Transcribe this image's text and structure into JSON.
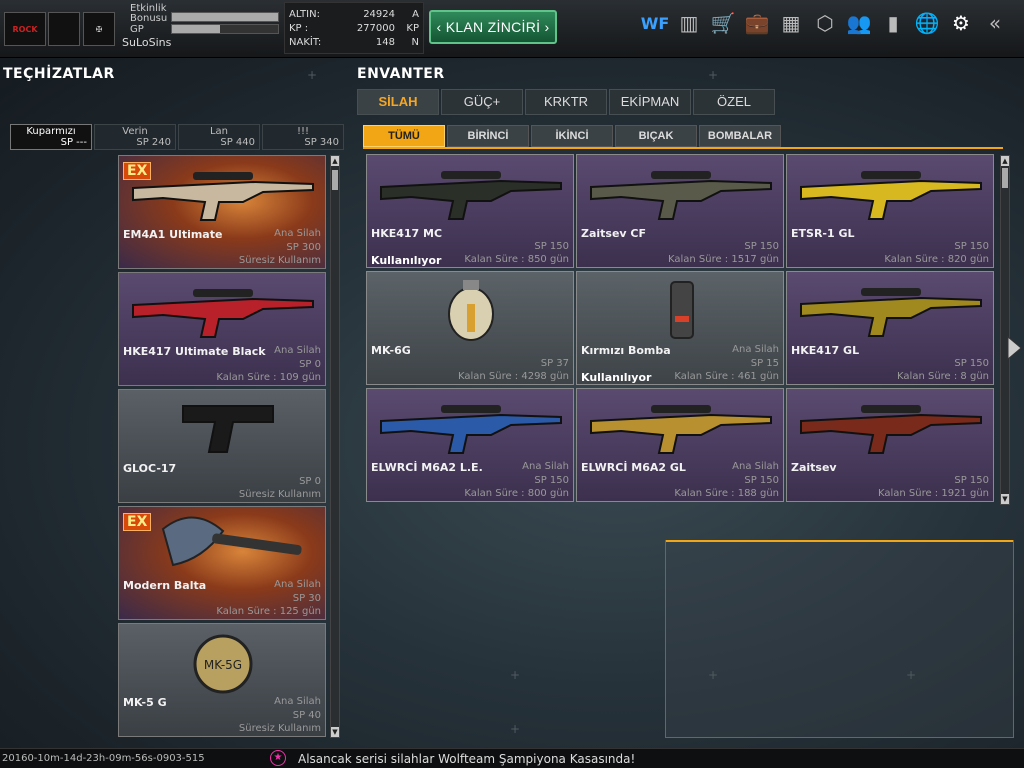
{
  "topbar": {
    "logo1": "ROCK",
    "logo2": "",
    "logo3": "",
    "event_label": "Etkinlik Bonusu",
    "event_bonus_fill": 1.0,
    "gp_label": "GP",
    "gp_fill": 0.45,
    "username": "SuLoSins",
    "currency": [
      {
        "label": "ALTIN:",
        "value": "24924",
        "unit": "A"
      },
      {
        "label": "KP :",
        "value": "277000",
        "unit": "KP"
      },
      {
        "label": "NAKİT:",
        "value": "148",
        "unit": "N"
      }
    ],
    "klan_button": "KLAN ZİNCİRİ",
    "icons": [
      {
        "name": "etkinlik-icon",
        "glyph": "WF"
      },
      {
        "name": "ranking-icon",
        "glyph": "▥"
      },
      {
        "name": "shop-cart-icon",
        "glyph": "🛒"
      },
      {
        "name": "briefcase-icon",
        "glyph": "💼"
      },
      {
        "name": "inventory-icon",
        "glyph": "▦"
      },
      {
        "name": "box-icon",
        "glyph": "⬡"
      },
      {
        "name": "friends-icon",
        "glyph": "👥"
      },
      {
        "name": "stats-icon",
        "glyph": "▮"
      },
      {
        "name": "globe-icon",
        "glyph": "🌐"
      },
      {
        "name": "gear-icon",
        "glyph": "⚙"
      },
      {
        "name": "back-arrows-icon",
        "glyph": "«"
      }
    ]
  },
  "left": {
    "title": "TEÇHİZATLAR",
    "tabs": [
      {
        "title": "Kuparmızı",
        "sp": "SP ---",
        "active": true
      },
      {
        "title": "Verin",
        "sp": "SP 240",
        "active": false
      },
      {
        "title": "Lan",
        "sp": "SP 440",
        "active": false
      },
      {
        "title": "!!!",
        "sp": "SP 340",
        "active": false
      }
    ],
    "items": [
      {
        "name": "EM4A1 Ultimate",
        "class": "Ana Silah",
        "sp": "SP 300",
        "duration": "Süresiz Kullanım",
        "ex": "EX",
        "style": "orange"
      },
      {
        "name": "HKE417 Ultimate Black",
        "class": "Ana Silah",
        "sp": "SP 0",
        "duration": "Kalan Süre : 109 gün",
        "ex": "",
        "style": "purple"
      },
      {
        "name": "GLOC-17",
        "class": "",
        "sp": "SP 0",
        "duration": "Süresiz Kullanım",
        "ex": "",
        "style": "grey"
      },
      {
        "name": "Modern Balta",
        "class": "Ana Silah",
        "sp": "SP 30",
        "duration": "Kalan Süre : 125 gün",
        "ex": "EX",
        "style": "orange"
      },
      {
        "name": "MK-5 G",
        "class": "Ana Silah",
        "sp": "SP 40",
        "duration": "Süresiz Kullanım",
        "ex": "",
        "style": "grey"
      }
    ]
  },
  "inventory": {
    "title": "ENVANTER",
    "tabs": [
      "SİLAH",
      "GÜÇ+",
      "KRKTR",
      "EKİPMAN",
      "ÖZEL"
    ],
    "active_tab": 0,
    "subtabs": [
      "TÜMÜ",
      "BİRİNCİ",
      "İKİNCİ",
      "BIÇAK",
      "BOMBALAR"
    ],
    "active_subtab": 0,
    "items": [
      {
        "name": "HKE417 MC",
        "class": "",
        "sp": "SP 150",
        "duration": "Kalan Süre : 850 gün",
        "in_use": "Kullanılıyor",
        "style": "purple"
      },
      {
        "name": "Zaitsev CF",
        "class": "",
        "sp": "SP 150",
        "duration": "Kalan Süre : 1517 gün",
        "in_use": "",
        "style": "purple"
      },
      {
        "name": "ETSR-1 GL",
        "class": "",
        "sp": "SP 150",
        "duration": "Kalan Süre : 820 gün",
        "in_use": "",
        "style": "purple"
      },
      {
        "name": "MK-6G",
        "class": "",
        "sp": "SP 37",
        "duration": "Kalan Süre : 4298 gün",
        "in_use": "",
        "style": "grey"
      },
      {
        "name": "Kırmızı Bomba",
        "class": "Ana Silah",
        "sp": "SP 15",
        "duration": "Kalan Süre : 461 gün",
        "in_use": "Kullanılıyor",
        "style": "grey"
      },
      {
        "name": "HKE417 GL",
        "class": "",
        "sp": "SP 150",
        "duration": "Kalan Süre : 8 gün",
        "in_use": "",
        "style": "purple"
      },
      {
        "name": "ELWRCİ M6A2 L.E.",
        "class": "Ana Silah",
        "sp": "SP 150",
        "duration": "Kalan Süre : 800 gün",
        "in_use": "",
        "style": "purple"
      },
      {
        "name": "ELWRCİ M6A2 GL",
        "class": "Ana Silah",
        "sp": "SP 150",
        "duration": "Kalan Süre : 188 gün",
        "in_use": "",
        "style": "purple"
      },
      {
        "name": "Zaitsev",
        "class": "",
        "sp": "SP 150",
        "duration": "Kalan Süre : 1921 gün",
        "in_use": "",
        "style": "purple"
      }
    ]
  },
  "footer": {
    "session_id": "20160-10m-14d-23h-09m-56s-0903-515",
    "news": "Alsancak serisi silahlar Wolfteam Şampiyona Kasasında!"
  },
  "colors": {
    "accent": "#f2a515",
    "klan_green": "#2f8a5a",
    "card_purple": "#5a4a70"
  }
}
